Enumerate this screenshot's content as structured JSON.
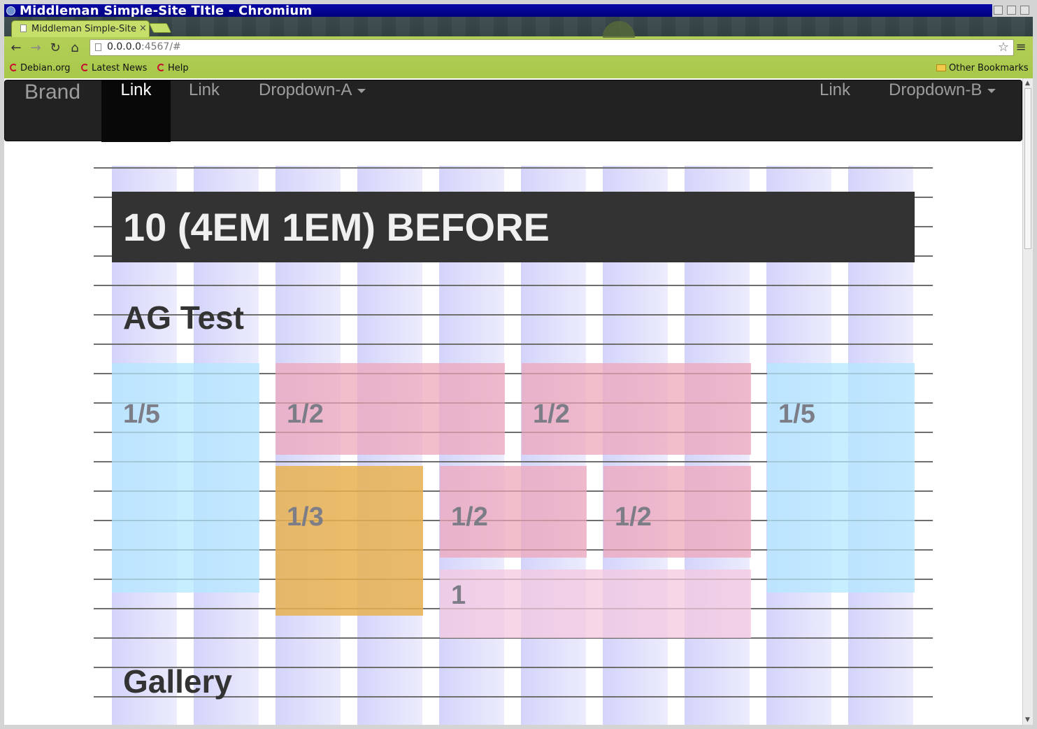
{
  "window": {
    "title": "Middleman Simple-Site TItle - Chromium"
  },
  "tab": {
    "title": "Middleman Simple-Site",
    "close": "×"
  },
  "toolbar": {
    "back": "←",
    "forward": "→",
    "reload": "↻",
    "home": "⌂",
    "url_host": "0.0.0.0",
    "url_rest": ":4567/#",
    "star": "☆",
    "menu": "≡"
  },
  "bookmarks": {
    "items": [
      "Debian.org",
      "Latest News",
      "Help"
    ],
    "other": "Other Bookmarks"
  },
  "navbar": {
    "brand": "Brand",
    "left": [
      "Link",
      "Link",
      "Dropdown-A"
    ],
    "right": [
      "Link",
      "Dropdown-B"
    ]
  },
  "page": {
    "banner": "10 (4EM 1EM) BEFORE",
    "section1": "AG Test",
    "section2": "Gallery",
    "blocks": {
      "left_fifth": "1/5",
      "half_a": "1/2",
      "half_b": "1/2",
      "right_fifth": "1/5",
      "third": "1/3",
      "half_c": "1/2",
      "half_d": "1/2",
      "one": "1"
    }
  },
  "colors": {
    "navbar": "#222222",
    "grid_column": "#d4d4fb",
    "block_blue": "#b4e8ff",
    "block_pink": "#eea5b9",
    "block_orange": "#e8b250",
    "chrome_frame": "#a8c84a"
  }
}
